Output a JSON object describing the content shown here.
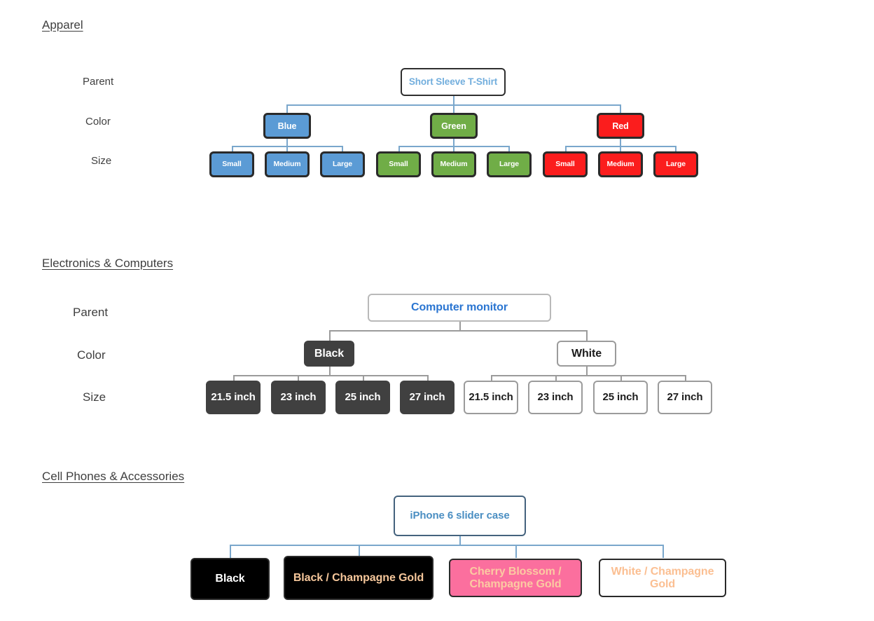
{
  "sections": [
    {
      "title": "Apparel",
      "row_labels": [
        "Parent",
        "Color",
        "Size"
      ],
      "parent": {
        "label": "Short Sleeve T-Shirt"
      },
      "colors": [
        {
          "label": "Blue",
          "swatch": "#5b9bd5"
        },
        {
          "label": "Green",
          "swatch": "#70ad47"
        },
        {
          "label": "Red",
          "swatch": "#fb1d1d"
        }
      ],
      "sizes": [
        {
          "label": "Small"
        },
        {
          "label": "Medium"
        },
        {
          "label": "Large"
        },
        {
          "label": "Small"
        },
        {
          "label": "Medium"
        },
        {
          "label": "Large"
        },
        {
          "label": "Small"
        },
        {
          "label": "Medium"
        },
        {
          "label": "Large"
        }
      ],
      "connector_color": "#7aa7cc"
    },
    {
      "title": "Electronics & Computers",
      "row_labels": [
        "Parent",
        "Color",
        "Size"
      ],
      "parent": {
        "label": "Computer monitor"
      },
      "colors": [
        {
          "label": "Black",
          "swatch": "#404040"
        },
        {
          "label": "White",
          "swatch": "#ffffff"
        }
      ],
      "sizes": [
        {
          "label": "21.5 inch"
        },
        {
          "label": "23 inch"
        },
        {
          "label": "25 inch"
        },
        {
          "label": "27 inch"
        },
        {
          "label": "21.5 inch"
        },
        {
          "label": "23 inch"
        },
        {
          "label": "25 inch"
        },
        {
          "label": "27 inch"
        }
      ],
      "connector_color": "#9b9b9b"
    },
    {
      "title": "Cell Phones & Accessories",
      "row_labels": [],
      "parent": {
        "label": "iPhone 6 slider case"
      },
      "colors": [
        {
          "label": "Black",
          "swatch": "#000000"
        },
        {
          "label": "Black / Champagne Gold",
          "swatch": "#000000"
        },
        {
          "label": "Cherry Blossom / Champagne Gold",
          "swatch": "#fb6f9e"
        },
        {
          "label": "White / Champagne Gold",
          "swatch": "#ffffff"
        }
      ],
      "sizes": [],
      "connector_color": "#7aa7cc"
    }
  ]
}
